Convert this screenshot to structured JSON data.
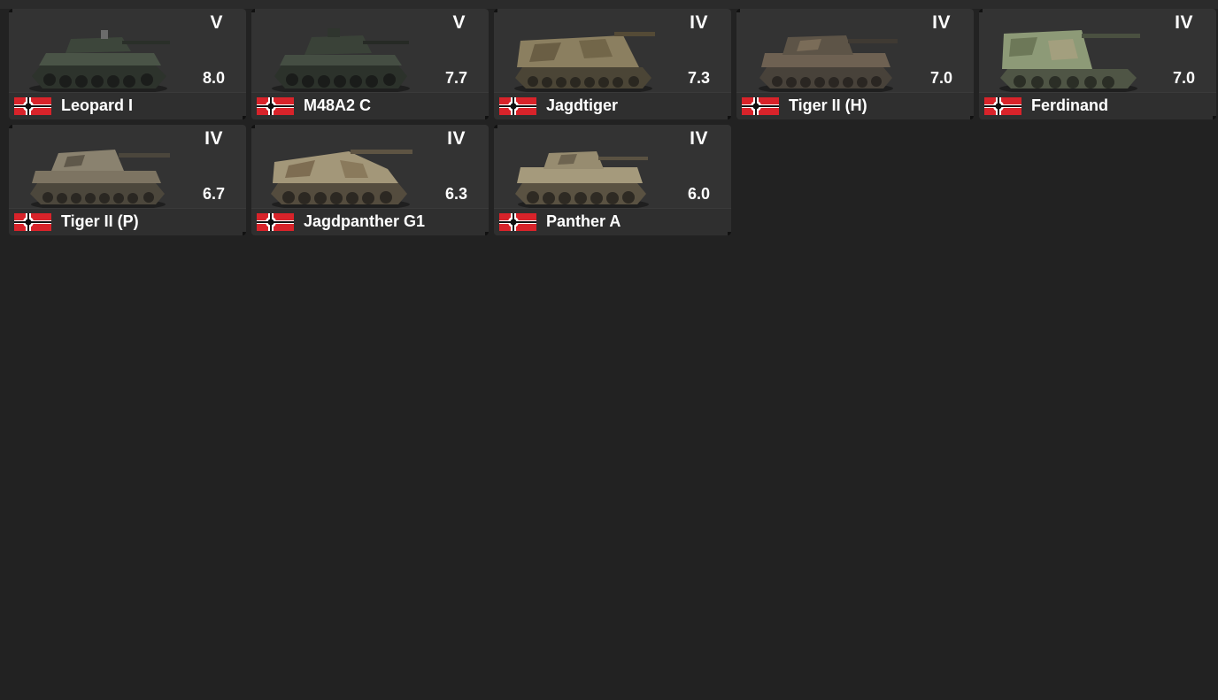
{
  "colors": {
    "background": "#222222",
    "card": "#333333",
    "text": "#ffffff",
    "flag_red": "#d8232a",
    "flag_white": "#ffffff",
    "flag_black": "#111111"
  },
  "vehicles": [
    {
      "name": "Leopard I",
      "rank": "V",
      "br": "8.0",
      "nation_icon": "german-war-ensign-icon",
      "camo": "dark-green"
    },
    {
      "name": "M48A2 C",
      "rank": "V",
      "br": "7.7",
      "nation_icon": "german-war-ensign-icon",
      "camo": "dark-green"
    },
    {
      "name": "Jagdtiger",
      "rank": "IV",
      "br": "7.3",
      "nation_icon": "german-war-ensign-icon",
      "camo": "tan-brown"
    },
    {
      "name": "Tiger II (H)",
      "rank": "IV",
      "br": "7.0",
      "nation_icon": "german-war-ensign-icon",
      "camo": "brown-grey"
    },
    {
      "name": "Ferdinand",
      "rank": "IV",
      "br": "7.0",
      "nation_icon": "german-war-ensign-icon",
      "camo": "green-tan"
    },
    {
      "name": "Tiger II (P)",
      "rank": "IV",
      "br": "6.7",
      "nation_icon": "german-war-ensign-icon",
      "camo": "tan-brown"
    },
    {
      "name": "Jagdpanther G1",
      "rank": "IV",
      "br": "6.3",
      "nation_icon": "german-war-ensign-icon",
      "camo": "tan-brown"
    },
    {
      "name": "Panther A",
      "rank": "IV",
      "br": "6.0",
      "nation_icon": "german-war-ensign-icon",
      "camo": "tan"
    }
  ]
}
